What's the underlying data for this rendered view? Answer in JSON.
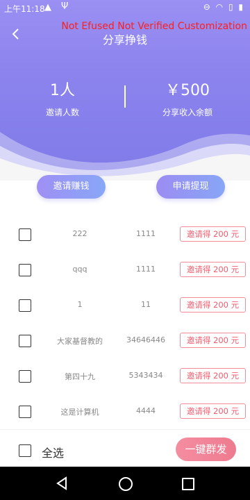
{
  "status_bar": {
    "time": "上午11:18",
    "icons": [
      "warning-icon",
      "usb-icon",
      "dnd-icon",
      "wifi-icon",
      "sim-icon",
      "battery-icon"
    ]
  },
  "header": {
    "title": "分享挣钱",
    "watermark": "Not Efused Not Verified Customization",
    "stats": {
      "invited_count": "1人",
      "invited_label": "邀请人数",
      "balance": "￥500",
      "balance_label": "分享收入余额"
    },
    "colors": {
      "gradient_top": "#9a8ff2",
      "gradient_bottom": "#7f7be8"
    }
  },
  "actions": {
    "invite_label": "邀请赚钱",
    "withdraw_label": "申请提现"
  },
  "list": {
    "rows": [
      {
        "name": "222",
        "number": "1111",
        "badge": "邀请得 200 元"
      },
      {
        "name": "qqq",
        "number": "1111",
        "badge": "邀请得 200 元"
      },
      {
        "name": "1",
        "number": "11",
        "badge": "邀请得 200 元"
      },
      {
        "name": "大家基督教的",
        "number": "34646446",
        "badge": "邀请得 200 元"
      },
      {
        "name": "第四十九",
        "number": "5343434",
        "badge": "邀请得 200 元"
      },
      {
        "name": "这是计算机",
        "number": "4444",
        "badge": "邀请得 200 元"
      }
    ]
  },
  "bottom": {
    "select_all_label": "全选",
    "broadcast_label": "一键群发",
    "accent": "#ee7b90"
  }
}
